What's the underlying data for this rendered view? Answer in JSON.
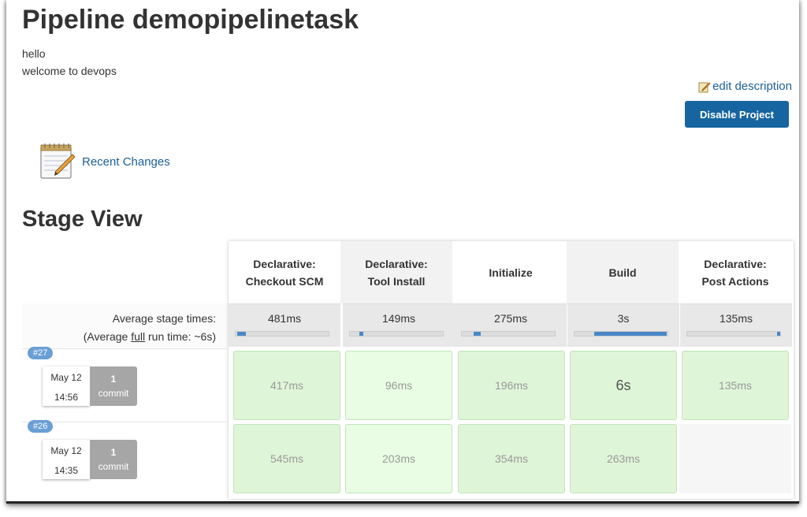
{
  "page": {
    "title": "Pipeline demopipelinetask"
  },
  "description": {
    "line1": "hello",
    "line2": "welcome to devops"
  },
  "actions": {
    "edit_description": "edit description",
    "disable_project": "Disable Project"
  },
  "recent_changes": {
    "label": "Recent Changes"
  },
  "stage_view": {
    "title": "Stage View",
    "average_label": "Average stage times:",
    "avg_full_prefix": "(Average ",
    "avg_full_word": "full",
    "avg_full_suffix": " run time: ~6s)",
    "stages": [
      {
        "line1": "Declarative:",
        "line2": "Checkout SCM",
        "avg": "481ms"
      },
      {
        "line1": "Declarative:",
        "line2": "Tool Install",
        "avg": "149ms"
      },
      {
        "line1": "Initialize",
        "line2": "",
        "avg": "275ms"
      },
      {
        "line1": "Build",
        "line2": "",
        "avg": "3s"
      },
      {
        "line1": "Declarative:",
        "line2": "Post Actions",
        "avg": "135ms"
      }
    ],
    "runs": [
      {
        "badge": "#27",
        "date": "May 12",
        "time": "14:56",
        "commits_count": "1",
        "commits_label": "commit",
        "times": [
          "417ms",
          "96ms",
          "196ms",
          "6s",
          "135ms"
        ]
      },
      {
        "badge": "#26",
        "date": "May 12",
        "time": "14:35",
        "commits_count": "1",
        "commits_label": "commit",
        "times": [
          "545ms",
          "203ms",
          "354ms",
          "263ms"
        ]
      }
    ]
  }
}
